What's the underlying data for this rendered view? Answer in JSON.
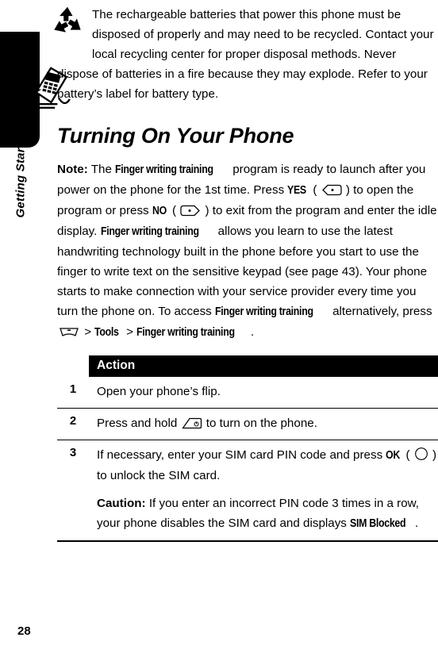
{
  "sidebar": {
    "tab_label": "Getting Started"
  },
  "page": {
    "number": "28"
  },
  "icons": {
    "recycle": "recycle-icon",
    "phone": "phone-illustration-icon",
    "softkey_left": "left-soft-key-icon",
    "softkey_right": "right-soft-key-icon",
    "menu_key": "menu-key-icon",
    "power_key": "power-key-icon",
    "ok_key": "ok-key-icon"
  },
  "intro": {
    "text": "The rechargeable batteries that power this phone must be disposed of properly and may need to be recycled. Contact your local recycling center for proper disposal methods. Never dispose of batteries in a fire because they may explode. Refer to your battery’s label for battery type."
  },
  "heading": {
    "title": "Turning On Your Phone"
  },
  "note": {
    "label": "Note:",
    "t1": " The ",
    "term1": "Finger writing training",
    "t2": " program is ready to launch after you power on the phone for the 1st time. Press ",
    "yes": "YES",
    "t3": " ( ",
    "t4": " ) to open the program or press ",
    "no": "NO",
    "t5": " ( ",
    "t6": " ) to exit from the program and enter the idle display. ",
    "term2": "Finger writing training",
    "t7": " allows you learn to use the latest handwriting technology built in the phone before you start to use the finger to write text on the sensitive keypad (see page 43). Your phone starts to make connection with your service provider every time you turn the phone on. To access ",
    "term3": "Finger writing training",
    "t8": " alternatively, press ",
    "t9": " > ",
    "tools": "Tools",
    "t10": " > ",
    "term4": "Finger writing training",
    "t11": "."
  },
  "table": {
    "header": "Action",
    "rows": [
      {
        "number": "1",
        "text": "Open your phone’s flip."
      },
      {
        "number": "2",
        "t1": "Press and hold ",
        "t2": " to turn on the phone."
      },
      {
        "number": "3",
        "t1": "If necessary, enter your SIM card PIN code and press ",
        "ok": "OK",
        "t2": " ( ",
        "t3": " ) to unlock the SIM card.",
        "caution_label": "Caution:",
        "caution_t1": " If you enter an incorrect PIN code 3 times in a row, your phone disables the SIM card and displays ",
        "caution_term": "SIM Blocked",
        "caution_t2": "."
      }
    ]
  }
}
